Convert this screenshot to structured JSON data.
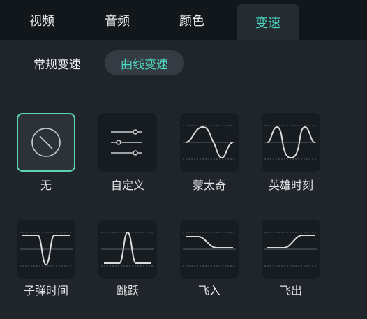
{
  "tabs": [
    "视频",
    "音频",
    "颜色",
    "变速"
  ],
  "active_tab": "变速",
  "subtabs": [
    "常规变速",
    "曲线变速"
  ],
  "active_subtab": "曲线变速",
  "presets": [
    {
      "label": "无",
      "icon": "none-icon",
      "selected": true
    },
    {
      "label": "自定义",
      "icon": "sliders-icon",
      "selected": false
    },
    {
      "label": "蒙太奇",
      "icon": "montage-curve-icon",
      "selected": false
    },
    {
      "label": "英雄时刻",
      "icon": "hero-moment-curve-icon",
      "selected": false
    },
    {
      "label": "子弹时间",
      "icon": "bullet-time-curve-icon",
      "selected": false
    },
    {
      "label": "跳跃",
      "icon": "jump-curve-icon",
      "selected": false
    },
    {
      "label": "飞入",
      "icon": "fly-in-curve-icon",
      "selected": false
    },
    {
      "label": "飞出",
      "icon": "fly-out-curve-icon",
      "selected": false
    }
  ],
  "colors": {
    "accent": "#4fd8c1",
    "selected_border": "#5cd3b6",
    "background": "#1f252a",
    "tab_bar": "#12171b"
  }
}
